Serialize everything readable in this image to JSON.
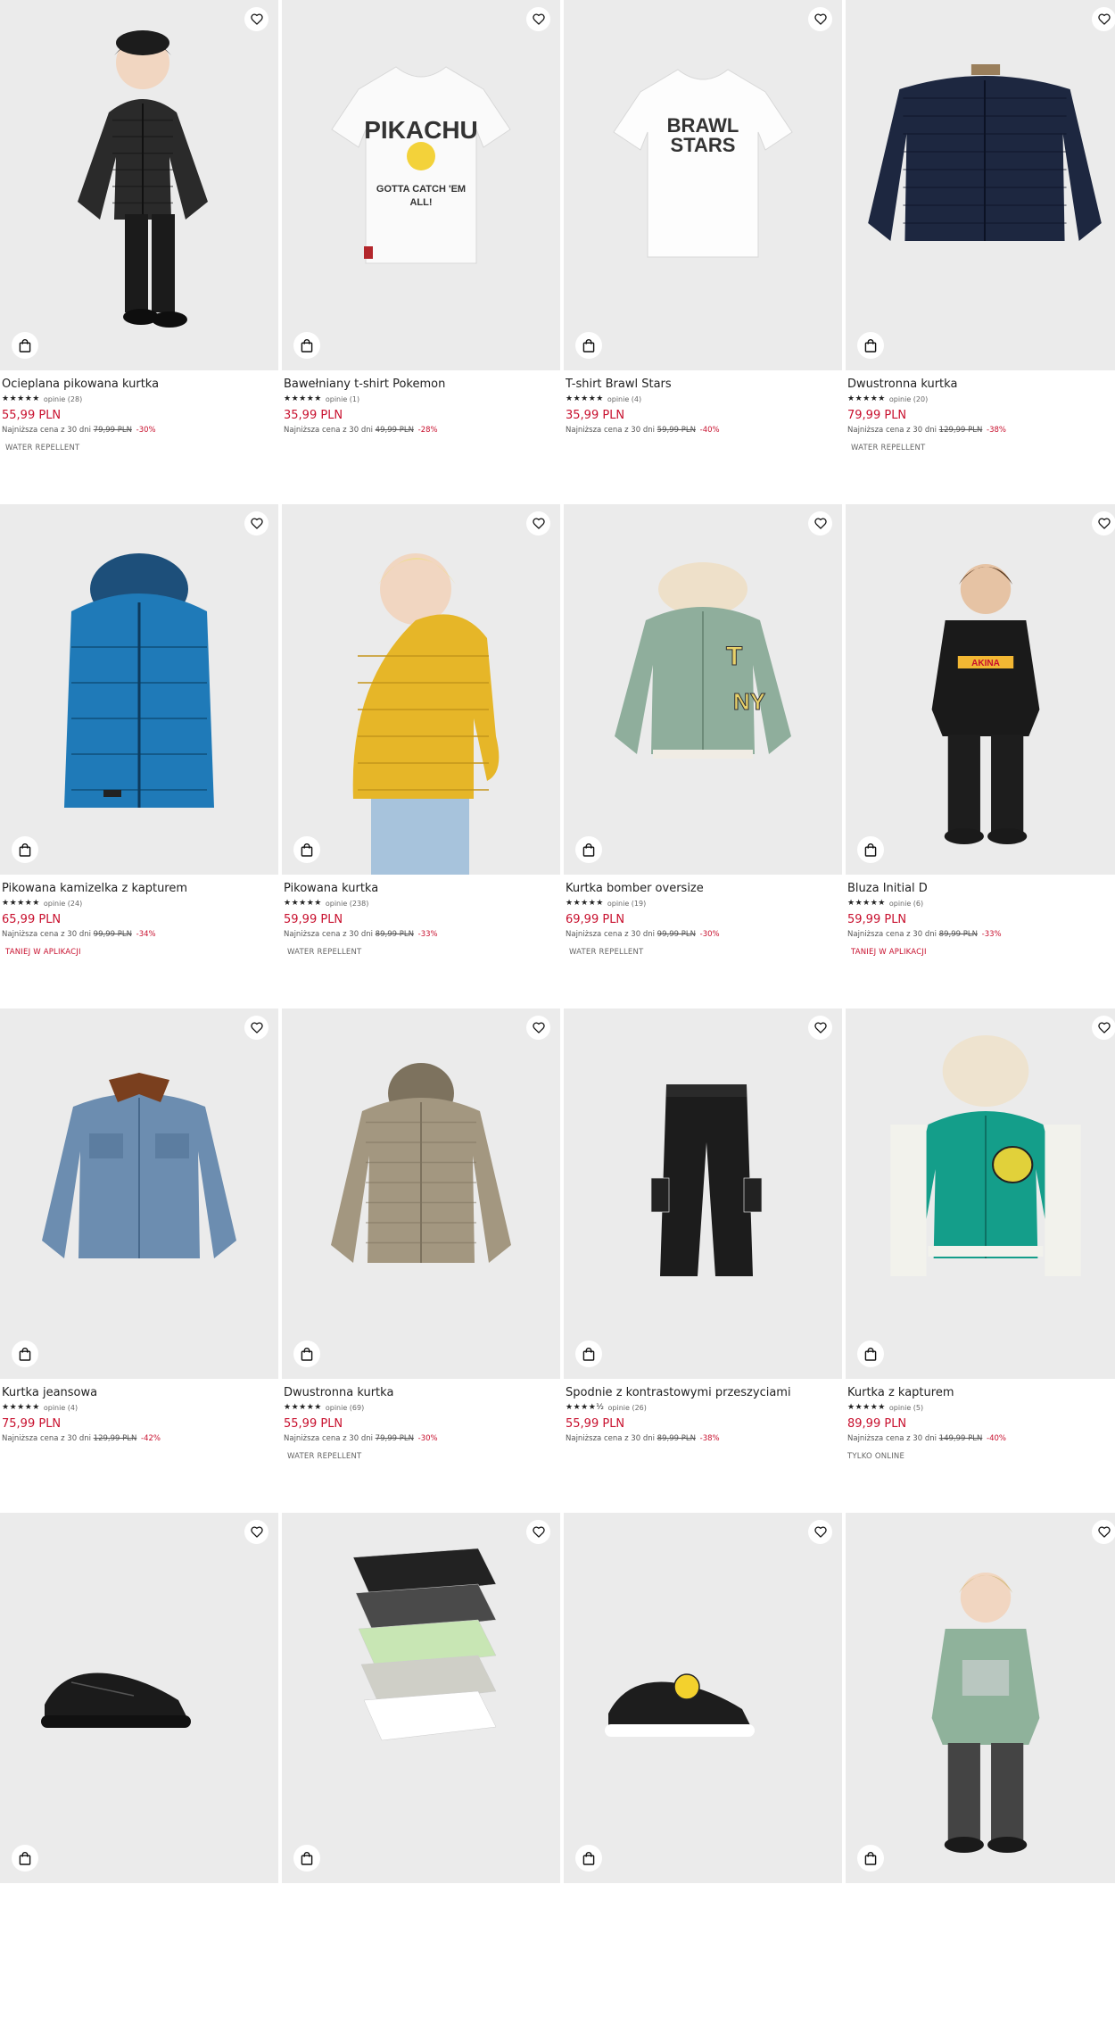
{
  "colors": {
    "price": "#c8102e",
    "tile_bg": "#ebebeb",
    "text": "#222222"
  },
  "icons": {
    "favorite": "heart-outline-icon",
    "cart": "shopping-bag-icon",
    "star": "star-icon"
  },
  "products": [
    {
      "name": "Ocieplana pikowana kurtka",
      "stars": "★★★★★",
      "reviews": "opinie (28)",
      "price": "55,99 PLN",
      "lowest_label": "Najniższa cena z 30 dni",
      "old_price": "79,99 PLN",
      "discount": "-30%",
      "badge": "WATER REPELLENT",
      "badge_style": "grey",
      "image": "black-puffer-jacket-boy"
    },
    {
      "name": "Bawełniany t-shirt Pokemon",
      "stars": "★★★★★",
      "reviews": "opinie (1)",
      "price": "35,99 PLN",
      "lowest_label": "Najniższa cena z 30 dni",
      "old_price": "49,99 PLN",
      "discount": "-28%",
      "badge": "",
      "badge_style": "grey",
      "image": "white-tshirt-pikachu",
      "print_text": [
        "PIKACHU",
        "GOTTA CATCH 'EM",
        "ALL!"
      ]
    },
    {
      "name": "T-shirt Brawl Stars",
      "stars": "★★★★★",
      "reviews": "opinie (4)",
      "price": "35,99 PLN",
      "lowest_label": "Najniższa cena z 30 dni",
      "old_price": "59,99 PLN",
      "discount": "-40%",
      "badge": "",
      "badge_style": "grey",
      "image": "white-tshirt-brawl-stars",
      "print_text": [
        "BRAWL",
        "STARS"
      ]
    },
    {
      "name": "Dwustronna kurtka",
      "stars": "★★★★★",
      "reviews": "opinie (20)",
      "price": "79,99 PLN",
      "lowest_label": "Najniższa cena z 30 dni",
      "old_price": "129,99 PLN",
      "discount": "-38%",
      "badge": "WATER REPELLENT",
      "badge_style": "grey",
      "image": "navy-quilted-jacket"
    },
    {
      "name": "Pikowana kamizelka z kapturem",
      "stars": "★★★★★",
      "reviews": "opinie (24)",
      "price": "65,99 PLN",
      "lowest_label": "Najniższa cena z 30 dni",
      "old_price": "99,99 PLN",
      "discount": "-34%",
      "badge": "TANIEJ W APLIKACJI",
      "badge_style": "red",
      "image": "blue-puffer-vest"
    },
    {
      "name": "Pikowana kurtka",
      "stars": "★★★★★",
      "reviews": "opinie (238)",
      "price": "59,99 PLN",
      "lowest_label": "Najniższa cena z 30 dni",
      "old_price": "89,99 PLN",
      "discount": "-33%",
      "badge": "WATER REPELLENT",
      "badge_style": "grey",
      "image": "yellow-puffer-boy"
    },
    {
      "name": "Kurtka bomber oversize",
      "stars": "★★★★★",
      "reviews": "opinie (19)",
      "price": "69,99 PLN",
      "lowest_label": "Najniższa cena z 30 dni",
      "old_price": "99,99 PLN",
      "discount": "-30%",
      "badge": "WATER REPELLENT",
      "badge_style": "grey",
      "image": "green-bomber-jacket"
    },
    {
      "name": "Bluza Initial D",
      "stars": "★★★★★",
      "reviews": "opinie (6)",
      "price": "59,99 PLN",
      "lowest_label": "Najniższa cena z 30 dni",
      "old_price": "89,99 PLN",
      "discount": "-33%",
      "badge": "TANIEJ W APLIKACJI",
      "badge_style": "red",
      "image": "black-hoodie-boy",
      "print_text": [
        "AKINA"
      ]
    },
    {
      "name": "Kurtka jeansowa",
      "stars": "★★★★★",
      "reviews": "opinie (4)",
      "price": "75,99 PLN",
      "lowest_label": "Najniższa cena z 30 dni",
      "old_price": "129,99 PLN",
      "discount": "-42%",
      "badge": "",
      "badge_style": "grey",
      "image": "denim-jacket"
    },
    {
      "name": "Dwustronna kurtka",
      "stars": "★★★★★",
      "reviews": "opinie (69)",
      "price": "55,99 PLN",
      "lowest_label": "Najniższa cena z 30 dni",
      "old_price": "79,99 PLN",
      "discount": "-30%",
      "badge": "WATER REPELLENT",
      "badge_style": "grey",
      "image": "beige-puffer-jacket"
    },
    {
      "name": "Spodnie z kontrastowymi przeszyciami",
      "stars": "★★★★½",
      "reviews": "opinie (26)",
      "price": "55,99 PLN",
      "lowest_label": "Najniższa cena z 30 dni",
      "old_price": "89,99 PLN",
      "discount": "-38%",
      "badge": "",
      "badge_style": "grey",
      "image": "black-cargo-pants"
    },
    {
      "name": "Kurtka z kapturem",
      "stars": "★★★★★",
      "reviews": "opinie (5)",
      "price": "89,99 PLN",
      "lowest_label": "Najniższa cena z 30 dni",
      "old_price": "149,99 PLN",
      "discount": "-40%",
      "badge": "TYLKO ONLINE",
      "badge_style": "plain",
      "image": "teal-varsity-hoodie"
    },
    {
      "name": "",
      "image": "black-sneakers"
    },
    {
      "name": "",
      "image": "tshirt-multipack"
    },
    {
      "name": "",
      "image": "black-smiley-sneaker"
    },
    {
      "name": "",
      "image": "green-tshirt-toddler"
    }
  ]
}
